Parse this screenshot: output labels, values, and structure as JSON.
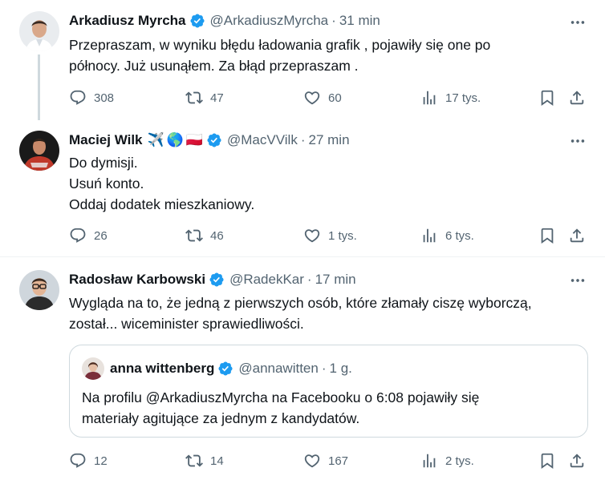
{
  "tweets": [
    {
      "name": "Arkadiusz Myrcha",
      "handle": "@ArkadiuszMyrcha",
      "time": "31 min",
      "lines": [
        "Przepraszam, w wyniku błędu ładowania grafik , pojawiły się one po",
        "północy. Już usunąłem. Za błąd przepraszam ."
      ],
      "replies": "308",
      "retweets": "47",
      "likes": "60",
      "views": "17 tys."
    },
    {
      "name": "Maciej Wilk",
      "emoji": [
        "✈️",
        "🌎",
        "🇵🇱"
      ],
      "handle": "@MacVVilk",
      "time": "27 min",
      "lines": [
        "Do dymisji.",
        "Usuń konto.",
        "Oddaj dodatek mieszkaniowy."
      ],
      "replies": "26",
      "retweets": "46",
      "likes": "1 tys.",
      "views": "6 tys."
    },
    {
      "name": "Radosław Karbowski",
      "handle": "@RadekKar",
      "time": "17 min",
      "lines": [
        "Wygląda na to, że jedną z pierwszych osób, które złamały ciszę wyborczą,",
        "został... wiceminister sprawiedliwości."
      ],
      "quote": {
        "name": "anna wittenberg",
        "handle": "@annawitten",
        "time": "1 g.",
        "lines": [
          "Na profilu @ArkadiuszMyrcha na Facebooku o 6:08 pojawiły się",
          "materiały agitujące za jednym z kandydatów."
        ]
      },
      "replies": "12",
      "retweets": "14",
      "likes": "167",
      "views": "2 tys."
    }
  ],
  "separator": "·",
  "colors": {
    "verified": "#1d9bf0",
    "secondary_text": "#536471",
    "border": "#cfd9de"
  }
}
